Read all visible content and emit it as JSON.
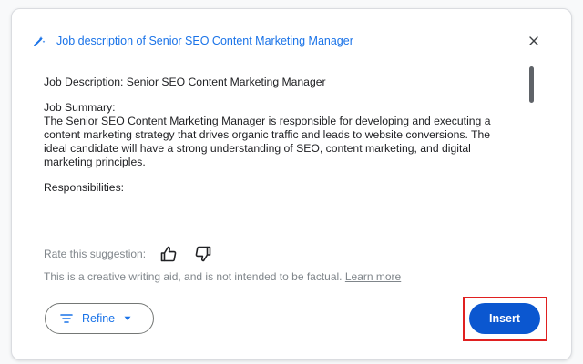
{
  "dialog": {
    "title": "Job description of Senior SEO Content Marketing Manager",
    "icon": "pen-sparkle-icon",
    "close_icon": "close-icon"
  },
  "content": {
    "heading": "Job Description: Senior SEO Content Marketing Manager",
    "summary_label": "Job Summary:",
    "summary_lines": [
      "The Senior SEO Content Marketing Manager is responsible for developing and executing a",
      "content marketing strategy that drives organic traffic and leads to website conversions. The",
      "ideal candidate will have a strong understanding of SEO, content marketing, and digital",
      "marketing principles."
    ],
    "responsibilities_label": "Responsibilities:"
  },
  "feedback": {
    "rate_label": "Rate this suggestion:",
    "thumbs_up_icon": "thumbs-up-icon",
    "thumbs_down_icon": "thumbs-down-icon"
  },
  "disclaimer": {
    "text": "This is a creative writing aid, and is not intended to be factual.",
    "link": "Learn more"
  },
  "actions": {
    "refine_label": "Refine",
    "refine_icon": "filter-lines-icon",
    "dropdown_icon": "caret-down-icon",
    "insert_label": "Insert"
  },
  "colors": {
    "accent": "#1a73e8",
    "primary_button": "#0b57d0",
    "highlight": "#e02020",
    "muted_text": "#80868b"
  }
}
